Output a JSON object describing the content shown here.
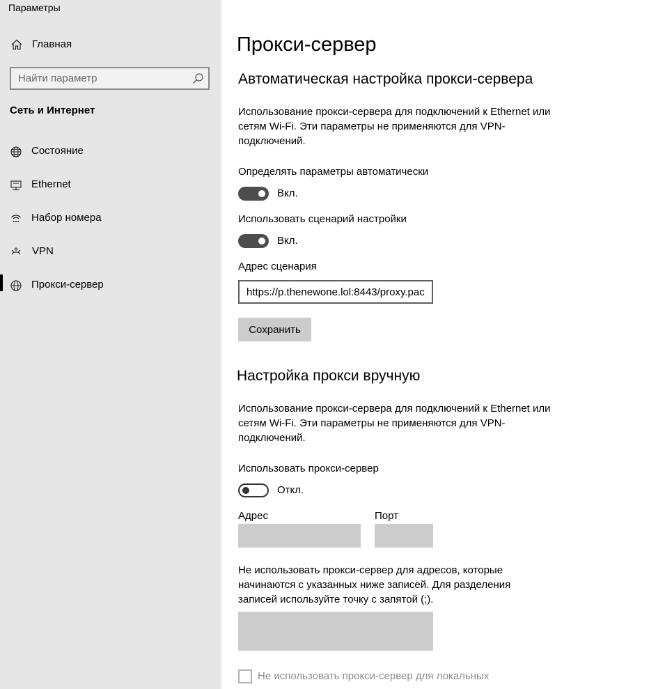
{
  "window": {
    "title": "Параметры"
  },
  "sidebar": {
    "home_label": "Главная",
    "search_placeholder": "Найти параметр",
    "section_title": "Сеть и Интернет",
    "items": [
      {
        "label": "Состояние",
        "icon": "globe-status-icon"
      },
      {
        "label": "Ethernet",
        "icon": "ethernet-icon"
      },
      {
        "label": "Набор номера",
        "icon": "dialup-icon"
      },
      {
        "label": "VPN",
        "icon": "vpn-icon"
      },
      {
        "label": "Прокси-сервер",
        "icon": "globe-icon",
        "active": true
      }
    ]
  },
  "main": {
    "title": "Прокси-сервер",
    "auto": {
      "heading": "Автоматическая настройка прокси-сервера",
      "description": "Использование прокси-сервера для подключений к Ethernet или сетям Wi-Fi. Эти параметры не применяются для VPN-подключений.",
      "detect_label": "Определять параметры автоматически",
      "detect_state": "Вкл.",
      "script_label": "Использовать сценарий настройки",
      "script_state": "Вкл.",
      "address_label": "Адрес сценария",
      "address_value": "https://p.thenewone.lol:8443/proxy.pac",
      "save_label": "Сохранить"
    },
    "manual": {
      "heading": "Настройка прокси вручную",
      "description": "Использование прокси-сервера для подключений к Ethernet или сетям Wi-Fi. Эти параметры не применяются для VPN-подключений.",
      "use_label": "Использовать прокси-сервер",
      "use_state": "Откл.",
      "address_label": "Адрес",
      "port_label": "Порт",
      "exceptions_description": "Не использовать прокси-сервер для адресов, которые начинаются с указанных ниже записей. Для разделения записей используйте точку с запятой (;).",
      "local_checkbox_label": "Не использовать прокси-сервер для локальных"
    }
  },
  "colors": {
    "sidebar_bg": "#e6e6e6",
    "toggle_on": "#4d4d4d",
    "disabled_field": "#cccccc"
  }
}
